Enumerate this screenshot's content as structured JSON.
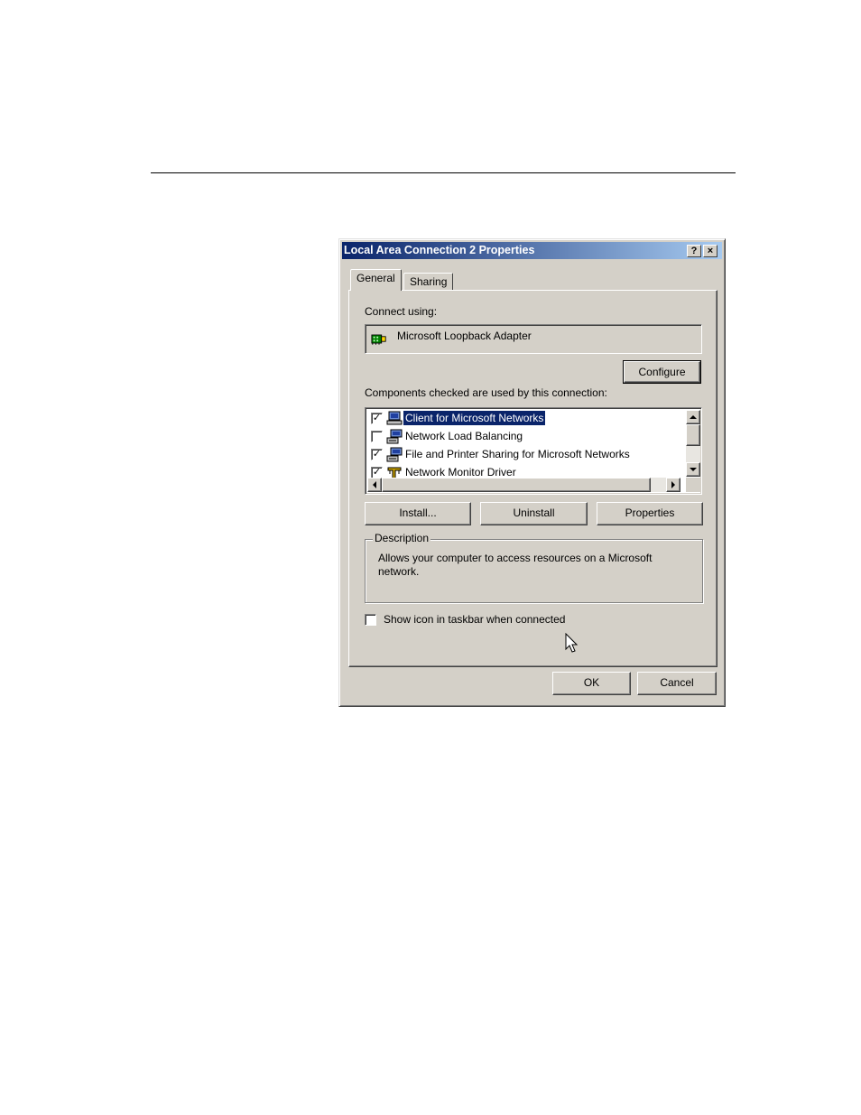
{
  "window": {
    "title": "Local Area Connection 2 Properties",
    "help_button": "?",
    "close_button": "×"
  },
  "tabs": [
    {
      "label": "General",
      "active": true
    },
    {
      "label": "Sharing",
      "active": false
    }
  ],
  "connect_using": {
    "label": "Connect using:",
    "adapter": "Microsoft Loopback Adapter",
    "adapter_icon": "network-adapter-icon",
    "configure_button": "Configure"
  },
  "components": {
    "label": "Components checked are used by this connection:",
    "items": [
      {
        "label": "Client for Microsoft Networks",
        "checked": true,
        "selected": true,
        "icon": "network-client-icon"
      },
      {
        "label": "Network Load Balancing",
        "checked": false,
        "selected": false,
        "icon": "network-service-icon"
      },
      {
        "label": "File and Printer Sharing for Microsoft Networks",
        "checked": true,
        "selected": false,
        "icon": "network-service-icon"
      },
      {
        "label": "Network Monitor Driver",
        "checked": true,
        "selected": false,
        "icon": "protocol-icon"
      }
    ]
  },
  "buttons": {
    "install": "Install...",
    "uninstall": "Uninstall",
    "properties": "Properties",
    "ok": "OK",
    "cancel": "Cancel"
  },
  "description": {
    "legend": "Description",
    "text": "Allows your computer to access resources on a Microsoft network."
  },
  "show_icon": {
    "label": "Show icon in taskbar when connected",
    "checked": false
  },
  "colors": {
    "face": "#d4d0c8",
    "title_start": "#0a246a",
    "title_end": "#a6caf0",
    "selection": "#0a246a"
  }
}
